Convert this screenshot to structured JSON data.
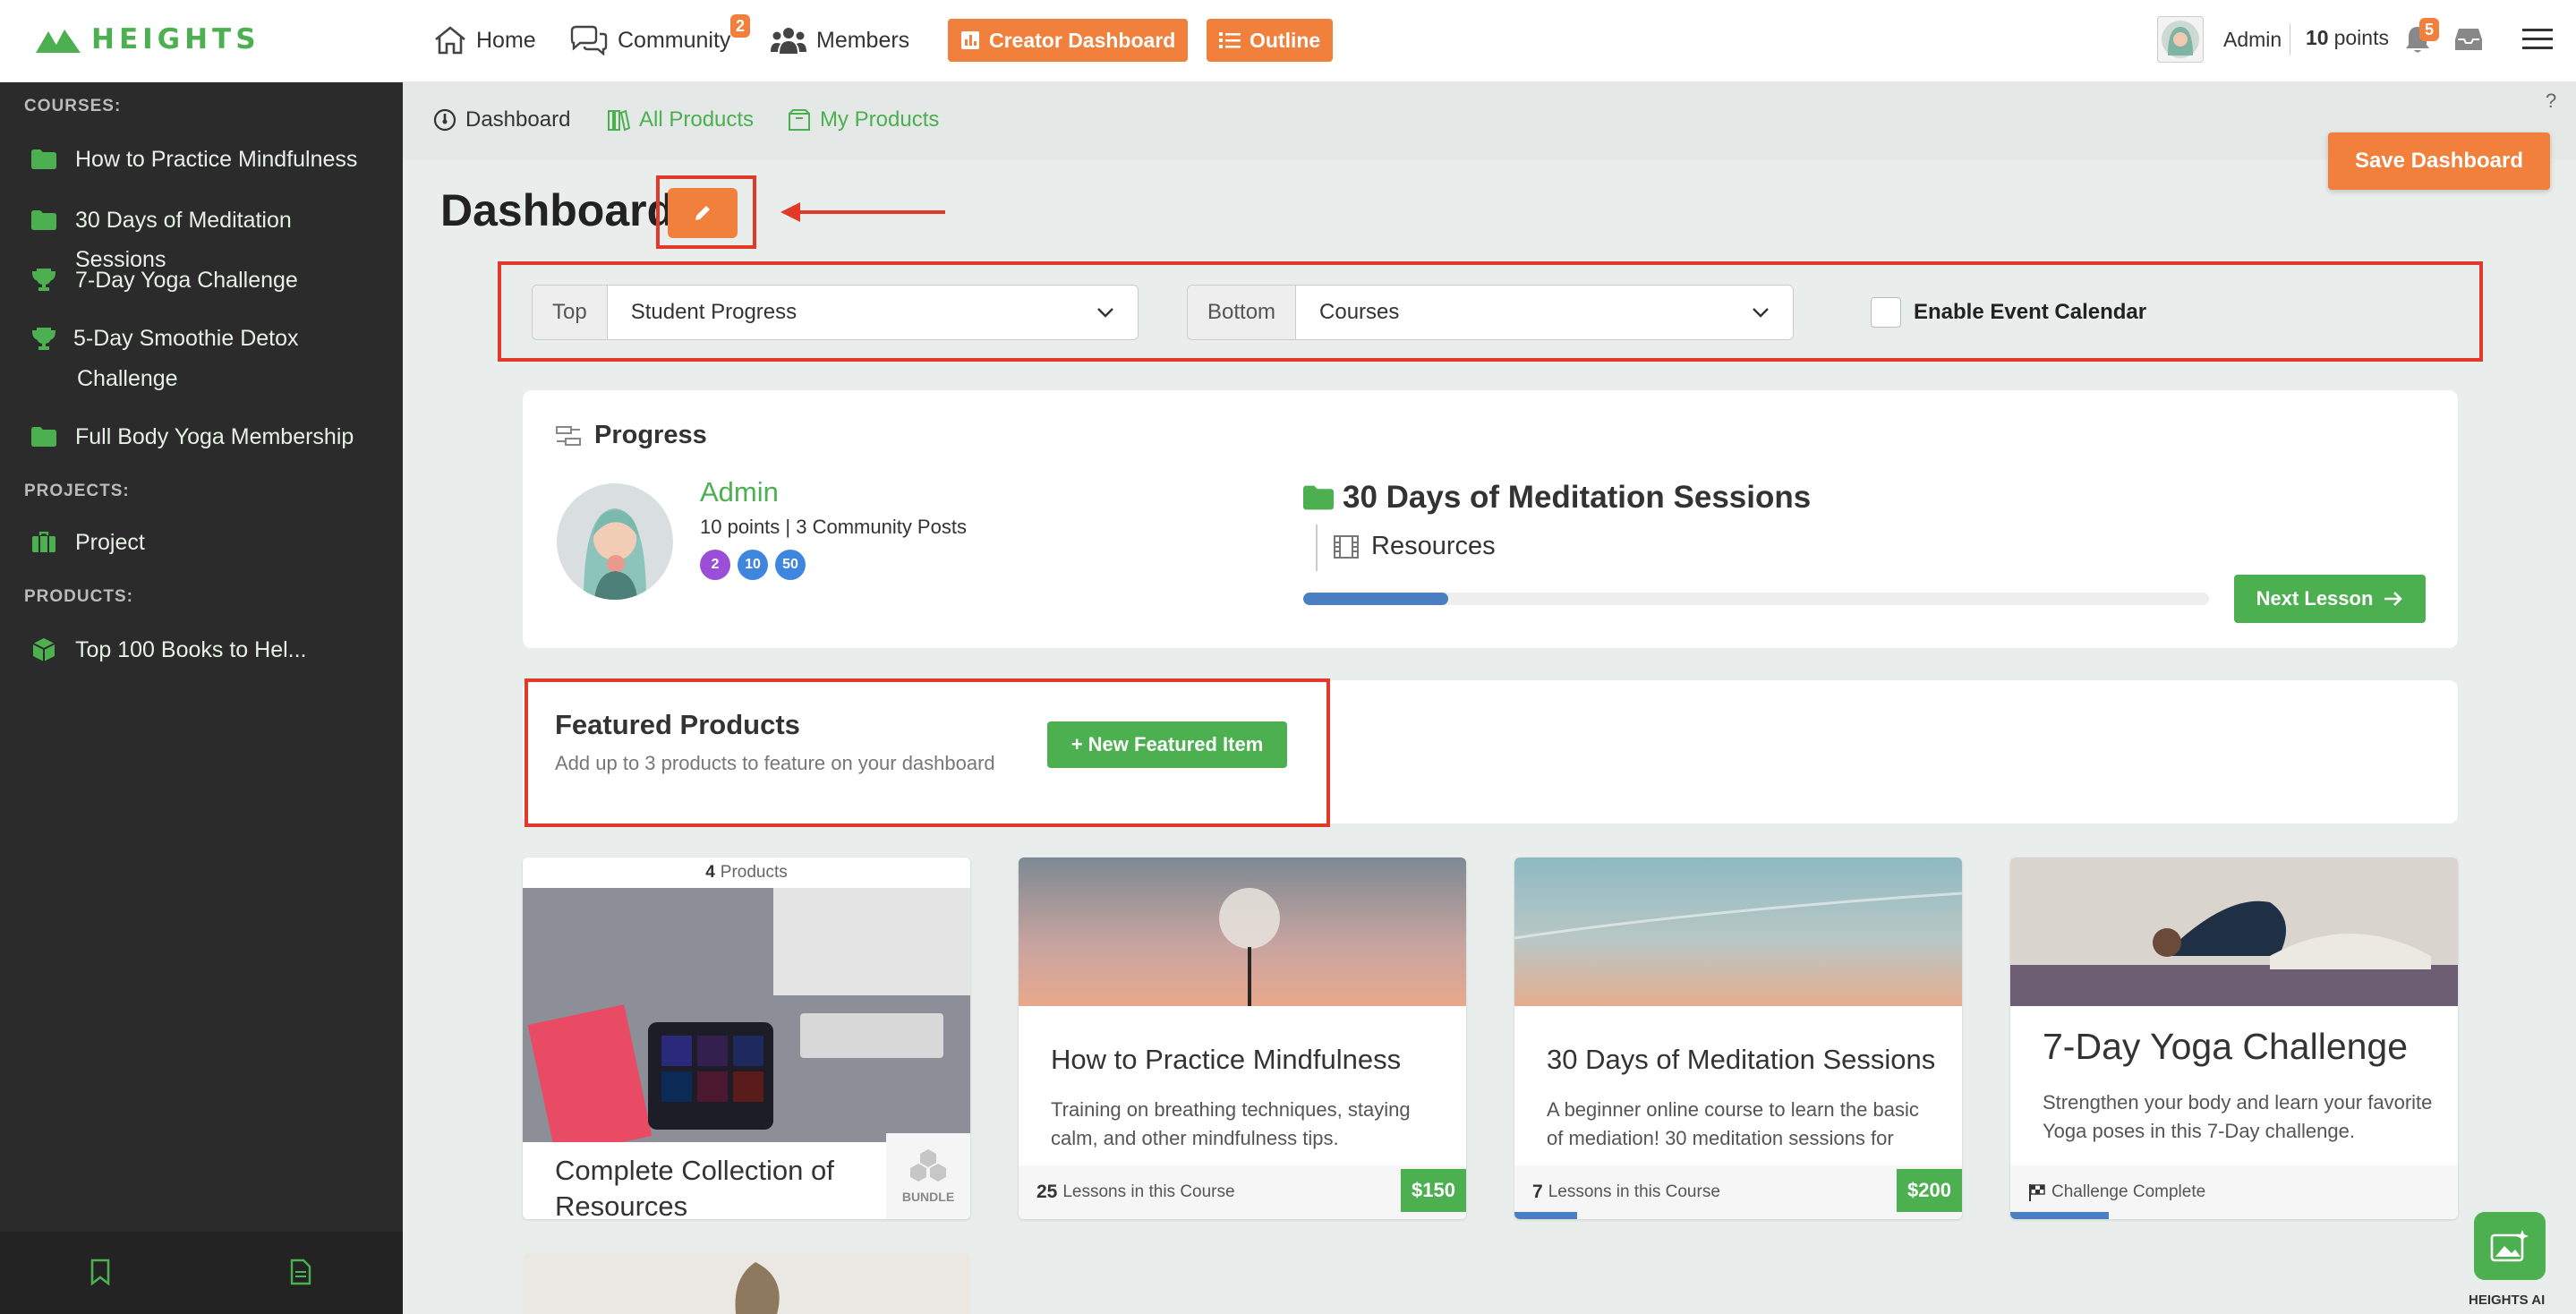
{
  "brand": {
    "name": "HEIGHTS",
    "color": "#4caf50"
  },
  "colors": {
    "accent": "#f0803c",
    "green": "#4caf50",
    "annotation_red": "#e2392b",
    "progress_blue": "#4a7fc1"
  },
  "topnav": {
    "home": "Home",
    "community": "Community",
    "community_badge": "2",
    "members": "Members",
    "creator_dashboard": "Creator Dashboard",
    "outline": "Outline",
    "user_name": "Admin",
    "points_value": "10",
    "points_label": "points",
    "notif_badge": "5"
  },
  "sidebar": {
    "courses_heading": "COURSES:",
    "courses": [
      {
        "label": "How to Practice Mindfulness",
        "icon": "folder-icon"
      },
      {
        "label": "30 Days of Meditation Sessions",
        "icon": "folder-icon"
      },
      {
        "label": "7-Day Yoga Challenge",
        "icon": "trophy-icon"
      },
      {
        "label": "5-Day Smoothie Detox Challenge",
        "icon": "trophy-icon"
      },
      {
        "label": "Full Body Yoga Membership",
        "icon": "folder-icon"
      }
    ],
    "projects_heading": "PROJECTS:",
    "projects": [
      {
        "label": "Project",
        "icon": "briefcase-icon"
      }
    ],
    "products_heading": "PRODUCTS:",
    "products": [
      {
        "label": "Top 100 Books to Hel...",
        "icon": "box-icon"
      }
    ]
  },
  "subnav": {
    "dashboard": "Dashboard",
    "all_products": "All Products",
    "my_products": "My Products",
    "help": "?"
  },
  "page": {
    "title": "Dashboard",
    "save_button": "Save Dashboard",
    "top_label": "Top",
    "top_value": "Student Progress",
    "bottom_label": "Bottom",
    "bottom_value": "Courses",
    "event_calendar_label": "Enable Event Calendar",
    "event_calendar_checked": false
  },
  "progress": {
    "heading": "Progress",
    "user_name": "Admin",
    "stats": "10 points | 3 Community Posts",
    "badges": [
      "2",
      "10",
      "50"
    ],
    "course_title": "30 Days of Meditation Sessions",
    "lesson": "Resources",
    "progress_fraction": 0.16,
    "next_lesson": "Next Lesson"
  },
  "featured": {
    "title": "Featured Products",
    "subtitle": "Add up to 3 products to feature on your dashboard",
    "new_button": "+ New Featured Item"
  },
  "products": [
    {
      "count_num": "4",
      "count_label": "Products",
      "title": "Complete Collection of Resources",
      "tag": "BUNDLE"
    },
    {
      "title": "How to Practice Mindfulness",
      "desc": "Training on breathing techniques, staying calm, and other mindfulness tips.",
      "lessons_num": "25",
      "lessons_label": "Lessons in this Course",
      "price": "$150",
      "progress_fraction": 0
    },
    {
      "title": "30 Days of Meditation Sessions",
      "desc": "A beginner online course to learn the basic of mediation! 30 meditation sessions for",
      "lessons_num": "7",
      "lessons_label": "Lessons in this Course",
      "price": "$200",
      "progress_fraction": 0.14
    },
    {
      "title": "7-Day Yoga Challenge",
      "desc": "Strengthen your body and learn your favorite Yoga poses in this 7-Day challenge.",
      "status": "Challenge Complete",
      "progress_fraction": 0.22
    }
  ],
  "ai": {
    "label": "HEIGHTS AI"
  }
}
